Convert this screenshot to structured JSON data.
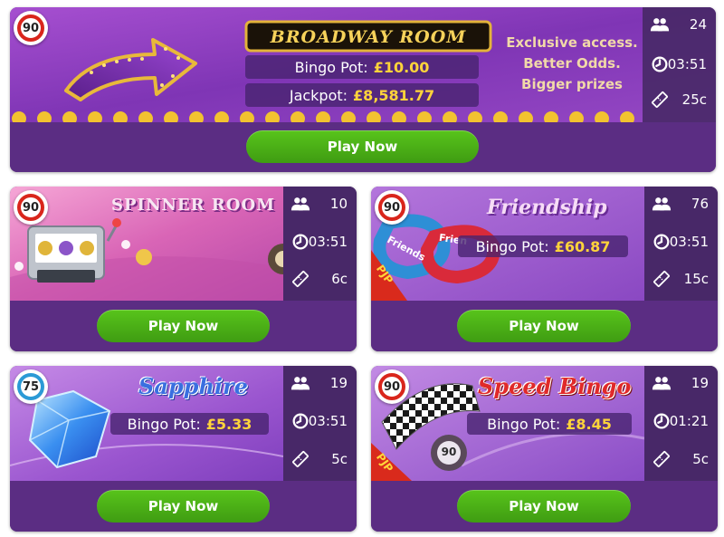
{
  "rooms": {
    "broadway": {
      "title": "BROADWAY ROOM",
      "ball_number": "90",
      "pot_label": "Bingo Pot:",
      "pot_amount": "£10.00",
      "jackpot_label": "Jackpot:",
      "jackpot_amount": "£8,581.77",
      "tagline": [
        "Exclusive access.",
        "Better Odds.",
        "Bigger prizes"
      ],
      "players": "24",
      "time": "03:51",
      "price": "25c",
      "button": "Play Now"
    },
    "spinner": {
      "title": "SPINNER ROOM",
      "ball_number": "90",
      "players": "10",
      "time": "03:51",
      "price": "6c",
      "button": "Play Now"
    },
    "friendship": {
      "title": "Friendship",
      "ball_number": "90",
      "ribbon_text": [
        "Friends",
        "Frien"
      ],
      "pjp_badge": "PJP",
      "pot_label": "Bingo Pot:",
      "pot_amount": "£60.87",
      "players": "76",
      "time": "03:51",
      "price": "15c",
      "button": "Play Now"
    },
    "sapphire": {
      "title": "Sapphire",
      "ball_number": "75",
      "pot_label": "Bingo Pot:",
      "pot_amount": "£5.33",
      "players": "19",
      "time": "03:51",
      "price": "5c",
      "button": "Play Now"
    },
    "speed": {
      "title": "Speed Bingo",
      "ball_number": "90",
      "pjp_badge": "PJP",
      "bingo_ball_number": "90",
      "pot_label": "Bingo Pot:",
      "pot_amount": "£8.45",
      "players": "19",
      "time": "01:21",
      "price": "5c",
      "button": "Play Now"
    }
  },
  "colors": {
    "card_bg": "#5b2d83",
    "button_green": "#4cb317",
    "amount_yellow": "#ffd43a",
    "ball_red": "#d9261c",
    "ball_blue": "#2b9ad6"
  },
  "icons": {
    "players": "players-icon",
    "time": "clock-icon",
    "price": "ticket-icon"
  }
}
